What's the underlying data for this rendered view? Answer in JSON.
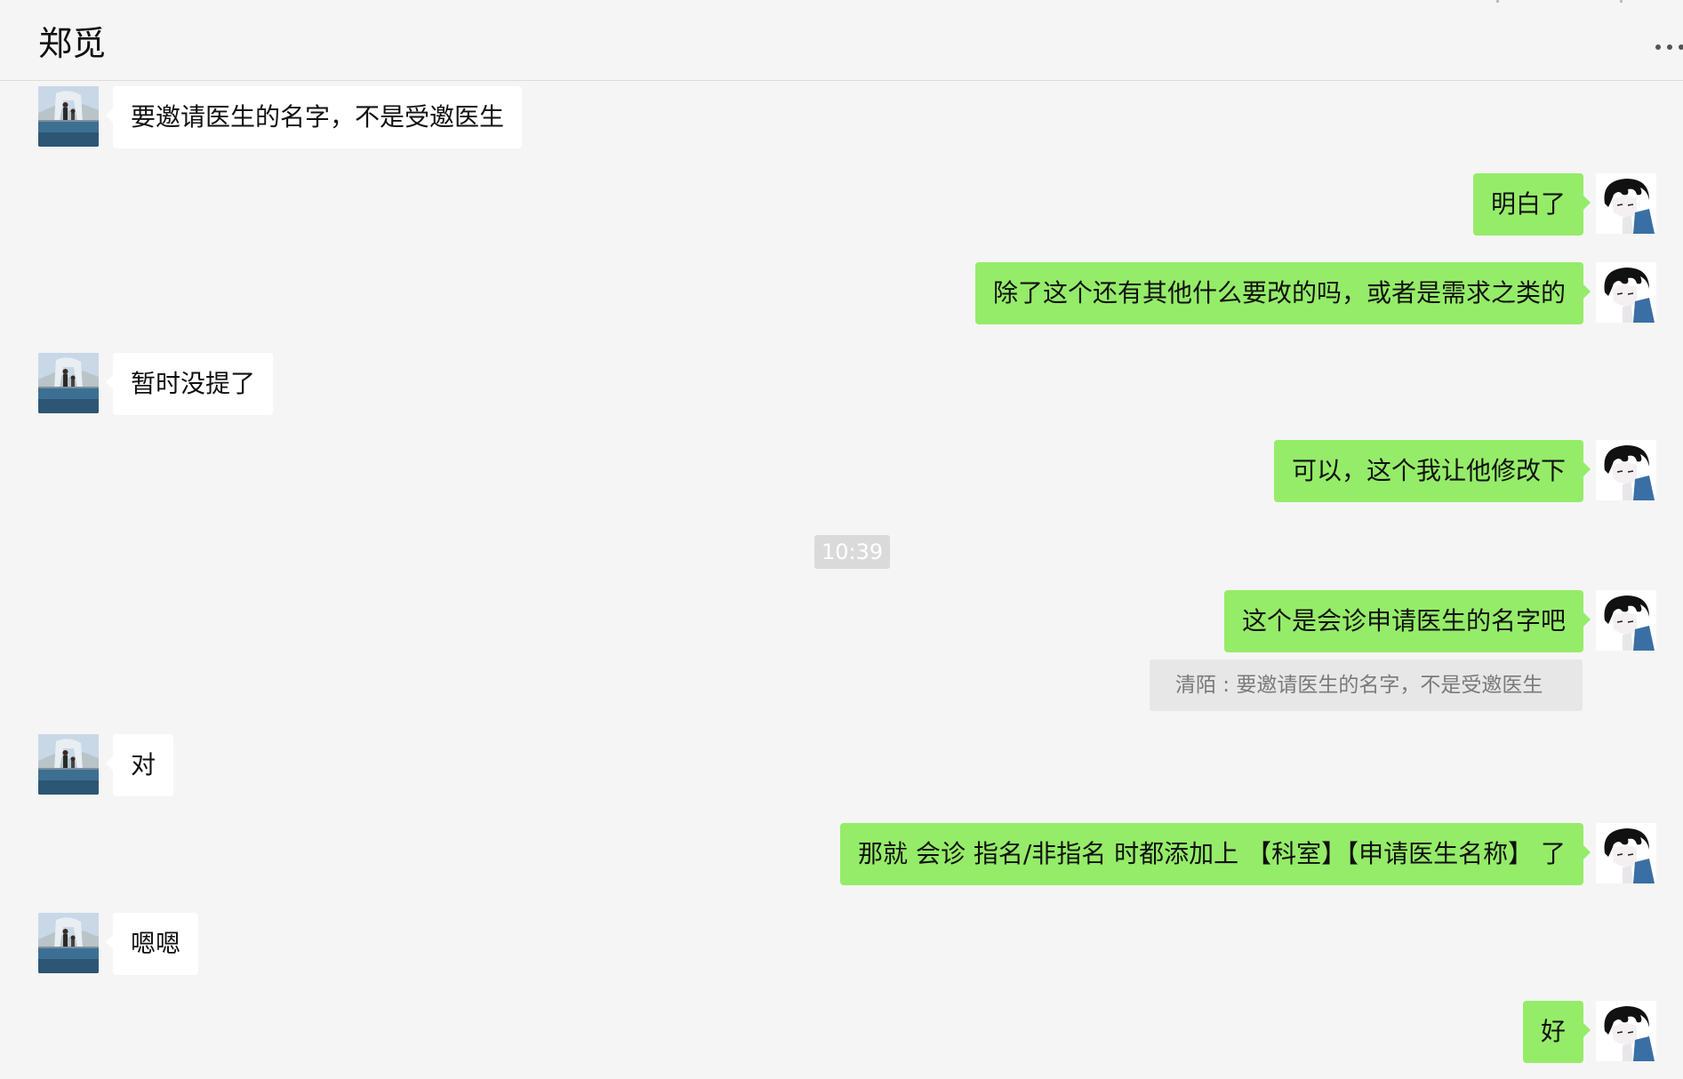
{
  "header": {
    "title": "郑觅",
    "more_icon": "more-horizontal-icon"
  },
  "colors": {
    "background": "#f5f5f5",
    "incoming_bubble": "#ffffff",
    "outgoing_bubble": "#95ec69",
    "quote_background": "#e7e7e7",
    "timestamp_background": "#dadada"
  },
  "messages": [
    {
      "direction": "in",
      "text": "要邀请医生的名字，不是受邀医生"
    },
    {
      "direction": "out",
      "text": "明白了"
    },
    {
      "direction": "out",
      "text": "除了这个还有其他什么要改的吗，或者是需求之类的"
    },
    {
      "direction": "in",
      "text": "暂时没提了"
    },
    {
      "direction": "out",
      "text": "可以，这个我让他修改下"
    },
    {
      "direction": "out",
      "text": "这个是会诊申请医生的名字吧"
    },
    {
      "direction": "in",
      "text": "对"
    },
    {
      "direction": "out",
      "text": "那就 会诊 指名/非指名 时都添加上 【科室】【申请医生名称】 了"
    },
    {
      "direction": "in",
      "text": "嗯嗯"
    },
    {
      "direction": "out",
      "text": "好"
    }
  ],
  "timestamp": "10:39",
  "quote": {
    "text": "清陌 : 要邀请医生的名字，不是受邀医生"
  }
}
